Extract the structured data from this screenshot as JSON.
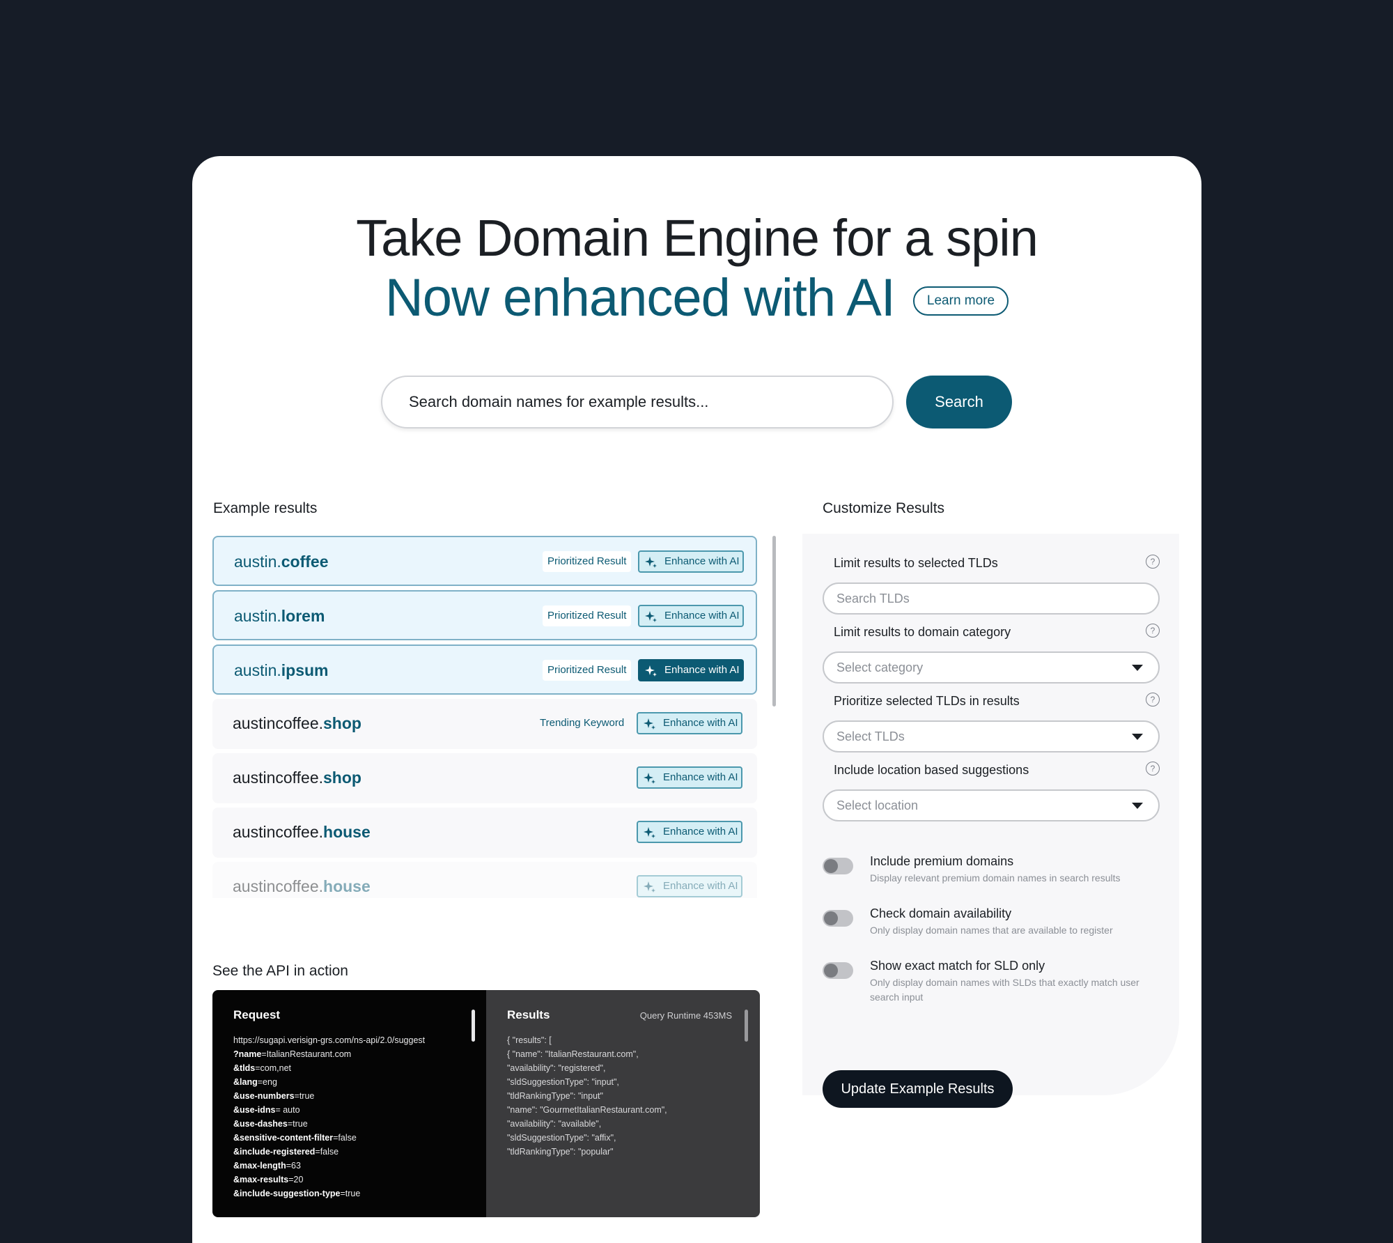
{
  "hero": {
    "title": "Take Domain Engine for a spin",
    "subtitle": "Now enhanced with AI",
    "learn_more": "Learn more"
  },
  "search": {
    "placeholder": "Search domain names for example results...",
    "button": "Search"
  },
  "results": {
    "heading": "Example results",
    "items": [
      {
        "sld": "austin.",
        "tld": "coffee",
        "tag": "Prioritized Result",
        "ai_label": "Enhance with AI"
      },
      {
        "sld": "austin.",
        "tld": "lorem",
        "tag": "Prioritized Result",
        "ai_label": "Enhance with AI"
      },
      {
        "sld": "austin.",
        "tld": "ipsum",
        "tag": "Prioritized Result",
        "ai_label": "Enhance with AI"
      },
      {
        "sld": "austincoffee.",
        "tld": "shop",
        "tag": "Trending Keyword",
        "ai_label": "Enhance with AI"
      },
      {
        "sld": "austincoffee.",
        "tld": "shop",
        "tag": "",
        "ai_label": "Enhance with AI"
      },
      {
        "sld": "austincoffee.",
        "tld": "house",
        "tag": "",
        "ai_label": "Enhance with AI"
      },
      {
        "sld": "austincoffee.",
        "tld": "house",
        "tag": "",
        "ai_label": "Enhance with AI"
      }
    ]
  },
  "api": {
    "heading": "See the API in action",
    "request_title": "Request",
    "request_url": "https://sugapi.verisign-grs.com/ns-api/2.0/suggest",
    "request_params": [
      {
        "key": "?name",
        "value": "=ItalianRestaurant.com"
      },
      {
        "key": "&tlds",
        "value": "=com,net"
      },
      {
        "key": "&lang",
        "value": "=eng"
      },
      {
        "key": "&use-numbers",
        "value": "=true"
      },
      {
        "key": "&use-idns",
        "value": "= auto"
      },
      {
        "key": "&use-dashes",
        "value": "=true"
      },
      {
        "key": "&sensitive-content-filter",
        "value": "=false"
      },
      {
        "key": "&include-registered",
        "value": "=false"
      },
      {
        "key": "&max-length",
        "value": "=63"
      },
      {
        "key": "&max-results",
        "value": "=20"
      },
      {
        "key": "&include-suggestion-type",
        "value": "=true"
      }
    ],
    "results_title": "Results",
    "runtime": "Query Runtime 453MS",
    "results_lines": [
      "{ \"results\": [",
      "{ \"name\": \"ItalianRestaurant.com\",",
      "\"availability\": \"registered\",",
      "\"sldSuggestionType\": \"input\",",
      "\"tldRankingType\": \"input\"",
      "\"name\": \"GourmetItalianRestaurant.com\",",
      "\"availability\": \"available\",",
      "\"sldSuggestionType\": \"affix\",",
      "\"tldRankingType\": \"popular\""
    ]
  },
  "customize": {
    "heading": "Customize Results",
    "fields": [
      {
        "label": "Limit results to selected TLDs",
        "placeholder": "Search TLDs"
      },
      {
        "label": "Limit results to domain category",
        "placeholder": "Select category"
      },
      {
        "label": "Prioritize selected TLDs in results",
        "placeholder": "Select TLDs"
      },
      {
        "label": "Include location based suggestions",
        "placeholder": "Select location"
      }
    ],
    "toggles": [
      {
        "title": "Include premium domains",
        "desc": "Display relevant premium domain names in search results"
      },
      {
        "title": "Check domain availability",
        "desc": "Only display domain names that are available to register"
      },
      {
        "title": "Show exact match for SLD only",
        "desc": "Only display domain names with SLDs that exactly match user search input"
      }
    ],
    "update_button": "Update Example Results"
  },
  "colors": {
    "brand": "#0c5a73",
    "background": "#161c27",
    "dark_button": "#0e1620"
  }
}
